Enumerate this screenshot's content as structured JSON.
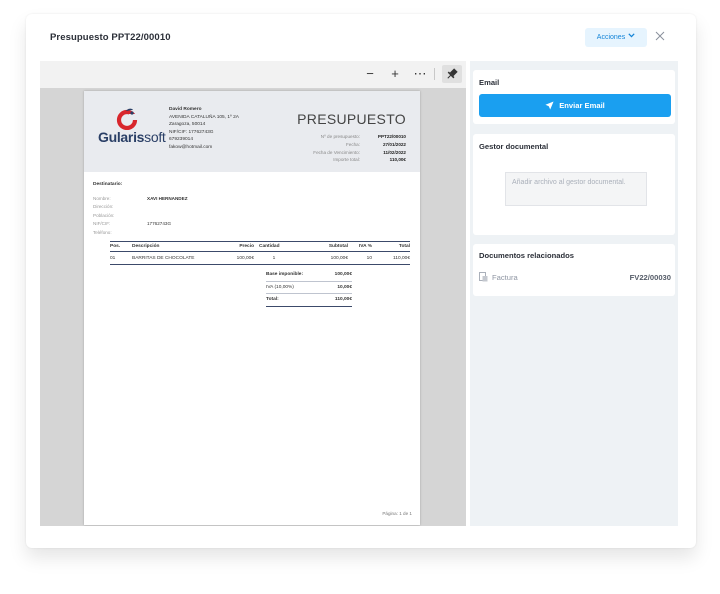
{
  "modal": {
    "title": "Presupuesto PPT22/00010",
    "actions_label": "Acciones",
    "close_icon": "close-icon"
  },
  "viewer": {
    "toolbar": {
      "zoom_out": "−",
      "zoom_in": "+",
      "more": "⋯",
      "pin_icon": "pin-icon"
    },
    "document": {
      "logo": {
        "strong": "Gularis",
        "light": "soft"
      },
      "sender": {
        "name": "David Romero",
        "address": "AVENIDA CATALUÑA 105, 1º 2A",
        "city": "Zaragoza, 50014",
        "nif": "NIF/CIF: 17762743G",
        "phone": "679239014",
        "email": "fakow@hotmail.com"
      },
      "title": "PRESUPUESTO",
      "meta": [
        {
          "label": "Nº de presupuesto:",
          "value": "PPT22/00010"
        },
        {
          "label": "Fecha:",
          "value": "27/01/2022"
        },
        {
          "label": "Fecha de Vencimiento:",
          "value": "11/02/2022"
        },
        {
          "label": "Importe total:",
          "value": "110,00€"
        }
      ],
      "recipient_heading": "Destinatario:",
      "recipient": [
        {
          "label": "Nombre:",
          "value": "XAVI HERNANDEZ"
        },
        {
          "label": "Dirección:",
          "value": ""
        },
        {
          "label": "Población:",
          "value": ""
        },
        {
          "label": "NIF/CIF:",
          "value": "17762743G"
        },
        {
          "label": "Teléfono:",
          "value": ""
        }
      ],
      "table": {
        "headers": [
          "Pos.",
          "Descripción",
          "Precio",
          "Cantidad",
          "Subtotal",
          "IVA %",
          "Total"
        ],
        "rows": [
          [
            "01",
            "BARRITAS DE CHOCOLATE",
            "100,00€",
            "1",
            "100,00€",
            "10",
            "110,00€"
          ]
        ]
      },
      "totals": [
        {
          "label": "Base imponible:",
          "value": "100,00€"
        },
        {
          "label": "IVA (10,00%)",
          "value": "10,00€"
        },
        {
          "label": "Total:",
          "value": "110,00€"
        }
      ],
      "page_label": "Página: 1 de 1"
    }
  },
  "panel": {
    "email": {
      "heading": "Email",
      "button": "Enviar Email"
    },
    "docs": {
      "heading": "Gestor documental",
      "drop_placeholder": "Añadir archivo al gestor documental."
    },
    "related": {
      "heading": "Documentos relacionados",
      "item_label": "Factura",
      "item_number": "FV22/00030"
    }
  },
  "colors": {
    "accent": "#1a9ff0",
    "accent_soft": "#e6f4fe",
    "logo_red": "#d8262c",
    "logo_navy": "#2a3f66"
  }
}
